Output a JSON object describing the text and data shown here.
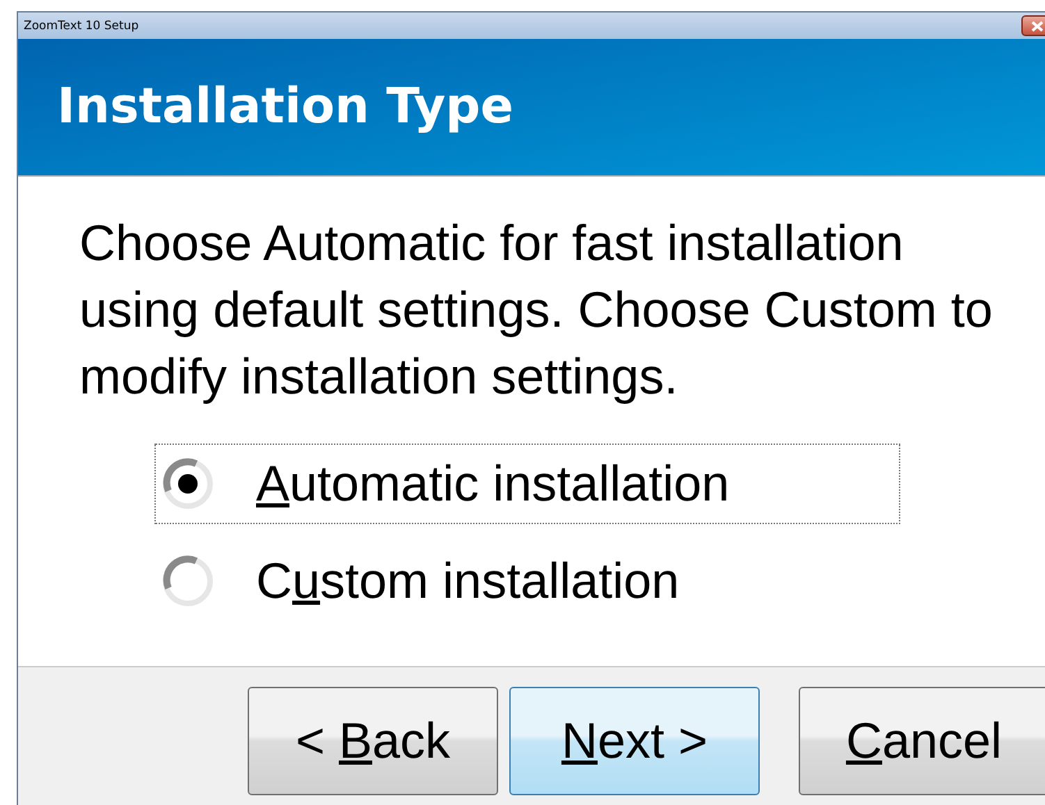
{
  "window": {
    "title": "ZoomText 10 Setup"
  },
  "header": {
    "title": "Installation Type"
  },
  "instructions": "Choose Automatic for fast installation using default settings. Choose Custom to modify installation settings.",
  "options": [
    {
      "key": "A",
      "rest": "utomatic installation",
      "selected": true,
      "focused": true
    },
    {
      "start": "C",
      "key": "u",
      "rest": "stom installation",
      "selected": false,
      "focused": false
    }
  ],
  "buttons": [
    {
      "start": "< ",
      "key": "B",
      "rest": "ack",
      "default": false
    },
    {
      "key": "N",
      "rest": "ext >",
      "default": true
    },
    {
      "key": "C",
      "rest": "ancel",
      "default": false
    }
  ]
}
